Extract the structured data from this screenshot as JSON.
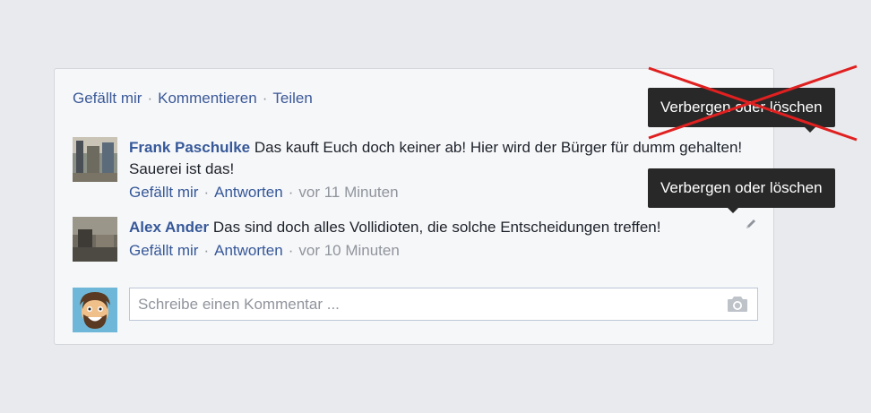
{
  "post_actions": {
    "like": "Gefällt mir",
    "comment": "Kommentieren",
    "share": "Teilen",
    "separator": "·"
  },
  "comments": [
    {
      "author": "Frank Paschulke",
      "text": "Das kauft Euch doch keiner ab! Hier wird der Bürger für dumm gehalten! Sauerei ist das!",
      "like_label": "Gefällt mir",
      "reply_label": "Antworten",
      "time": "vor 11 Minuten"
    },
    {
      "author": "Alex Ander",
      "text": "Das sind doch alles Vollidioten, die solche Entscheidungen treffen!",
      "like_label": "Gefällt mir",
      "reply_label": "Antworten",
      "time": "vor 10 Minuten"
    }
  ],
  "composer": {
    "placeholder": "Schreibe einen Kommentar ..."
  },
  "tooltips": {
    "crossed_out": "Verbergen oder löschen",
    "active": "Verbergen oder löschen"
  },
  "icons": {
    "edit": "pencil-icon",
    "camera": "camera-icon"
  },
  "colors": {
    "link": "#365899",
    "cross": "#e02020",
    "tooltip_bg": "#282828"
  }
}
